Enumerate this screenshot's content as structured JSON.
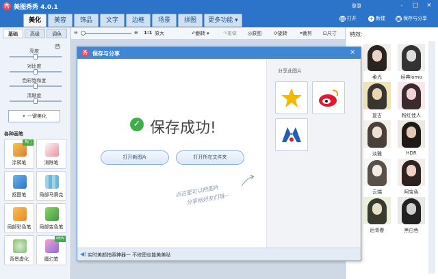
{
  "app": {
    "title": "美图秀秀 4.0.1",
    "login": "登录",
    "logo_char": "秀"
  },
  "window_controls": [
    "-",
    "□",
    "×"
  ],
  "tabs": [
    "美化",
    "美容",
    "饰品",
    "文字",
    "边框",
    "场景",
    "拼图",
    "更多功能 ▾"
  ],
  "tab_actions": {
    "open": "打开",
    "new": "新建",
    "save_share": "保存与分享"
  },
  "toolbar": {
    "zoom_ratio": "1:1",
    "original": "原大",
    "rotate": "翻转",
    "undo": "撤销",
    "redo": "重做",
    "compare": "原图",
    "flip": "旋转",
    "crop": "裁剪",
    "size": "尺寸"
  },
  "left_tabs": [
    "基础",
    "高级",
    "调色"
  ],
  "sliders": [
    {
      "label": "亮度",
      "value": 0.5
    },
    {
      "label": "对比度",
      "value": 0.5
    },
    {
      "label": "色彩饱和度",
      "value": 0.5
    },
    {
      "label": "清晰度",
      "value": 0.5
    }
  ],
  "beautify_button": "一键美化",
  "brush_section": {
    "title": "各种画笔",
    "tools": [
      {
        "label": "涂鸦笔",
        "badge": "热门"
      },
      {
        "label": "消除笔",
        "badge": ""
      },
      {
        "label": "抠图笔",
        "badge": ""
      },
      {
        "label": "局部马赛克",
        "badge": ""
      },
      {
        "label": "局部彩色笔",
        "badge": ""
      },
      {
        "label": "局部变色笔",
        "badge": ""
      },
      {
        "label": "背景虚化",
        "badge": ""
      },
      {
        "label": "魔幻笔",
        "badge": "NEW"
      }
    ]
  },
  "effects": {
    "title": "特效:",
    "items": [
      "柔光",
      "经典lomo",
      "复古",
      "粉红佳人",
      "淡雅",
      "HDR",
      "云端",
      "阿宝色",
      "后青春",
      "黑白色"
    ]
  },
  "dialog": {
    "title": "保存与分享",
    "success": "保存成功!",
    "open_new": "打开新图片",
    "open_folder": "打开所在文件夹",
    "hint_line1": "点这里可以把图片",
    "hint_line2": "分享给好友们哦~",
    "share_title": "分享此图片",
    "share_targets": [
      "QQ空间",
      "新浪微博",
      "人人网"
    ],
    "footer": "实时美颜拍照神器一 不修图也能美美哒"
  },
  "colors": {
    "titlebar": "#2b74c9",
    "dialog_title": "#3f86d4",
    "success": "#3fae49"
  }
}
